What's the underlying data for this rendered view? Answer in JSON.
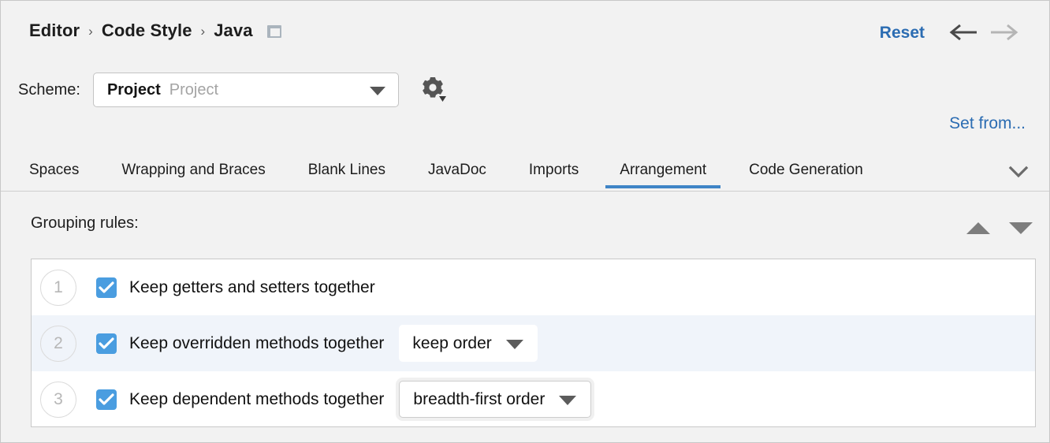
{
  "breadcrumb": {
    "items": [
      "Editor",
      "Code Style",
      "Java"
    ],
    "separator": "›",
    "trailing_icon": "window-icon"
  },
  "header": {
    "reset_label": "Reset",
    "back_icon": "arrow-left-icon",
    "forward_icon": "arrow-right-icon",
    "back_enabled": "true",
    "forward_enabled": "false"
  },
  "scheme": {
    "label": "Scheme:",
    "value": "Project",
    "placeholder": "Project",
    "dropdown_icon": "chevron-down-icon",
    "gear_icon": "gear-icon"
  },
  "set_from": {
    "label": "Set from..."
  },
  "tabs": {
    "items": [
      {
        "label": "Spaces",
        "active": false
      },
      {
        "label": "Wrapping and Braces",
        "active": false
      },
      {
        "label": "Blank Lines",
        "active": false
      },
      {
        "label": "JavaDoc",
        "active": false
      },
      {
        "label": "Imports",
        "active": false
      },
      {
        "label": "Arrangement",
        "active": true
      },
      {
        "label": "Code Generation",
        "active": false
      }
    ],
    "overflow_icon": "chevron-down-icon",
    "active_underline_color": "#3f84c6"
  },
  "grouping": {
    "title": "Grouping rules:",
    "move_up_icon": "triangle-up-icon",
    "move_down_icon": "triangle-down-icon",
    "rules": [
      {
        "number": "1",
        "checked": true,
        "label": "Keep getters and setters together",
        "order": null,
        "selected": false
      },
      {
        "number": "2",
        "checked": true,
        "label": "Keep overridden methods together",
        "order": "keep order",
        "selected": true
      },
      {
        "number": "3",
        "checked": true,
        "label": "Keep dependent methods together",
        "order": "breadth-first order",
        "selected": false
      }
    ]
  },
  "colors": {
    "accent_link": "#2b6cb2",
    "checkbox_blue": "#4a9de0",
    "tab_underline": "#3f84c6",
    "selected_row": "#f0f4fa",
    "background": "#f2f2f2"
  }
}
